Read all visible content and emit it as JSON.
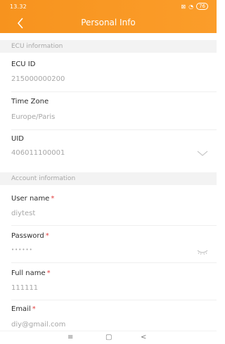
{
  "status": {
    "time": "13.32",
    "battery": "76"
  },
  "header": {
    "title": "Personal Info"
  },
  "sections": {
    "ecu": "ECU information",
    "account": "Account information"
  },
  "ecu": {
    "id_label": "ECU ID",
    "id_value": "215000000200",
    "tz_label": "Time Zone",
    "tz_value": "Europe/Paris",
    "uid_label": "UID",
    "uid_value": "406011100001"
  },
  "account": {
    "user_label": "User name",
    "user_value": "diytest",
    "pass_label": "Password",
    "pass_value": "••••••",
    "fullname_label": "Full name",
    "fullname_value": "111111",
    "email_label": "Email",
    "email_value": "diy@gmail.com"
  },
  "nav": {
    "menu": "≡",
    "home": "▢",
    "back": "<"
  },
  "colors": {
    "accent": "#f7931e",
    "required": "#e34040"
  }
}
